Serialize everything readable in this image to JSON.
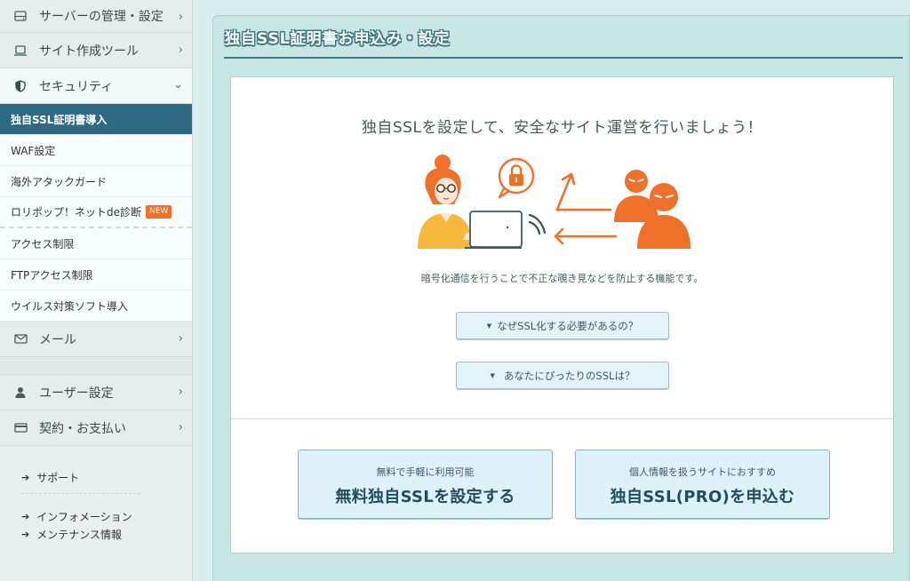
{
  "sidebar": {
    "categories": {
      "server": {
        "label": "サーバーの管理・設定",
        "icon": "server-icon"
      },
      "site": {
        "label": "サイト作成ツール",
        "icon": "laptop-icon"
      },
      "security": {
        "label": "セキュリティ",
        "icon": "shield-icon"
      },
      "mail": {
        "label": "メール",
        "icon": "mail-icon"
      },
      "user": {
        "label": "ユーザー設定",
        "icon": "user-icon"
      },
      "contract": {
        "label": "契約・お支払い",
        "icon": "card-icon"
      }
    },
    "security_items": [
      {
        "label": "独自SSL証明書導入"
      },
      {
        "label": "WAF設定"
      },
      {
        "label": "海外アタックガード"
      },
      {
        "label": "ロリポップ！ネットde診断",
        "badge": "NEW"
      },
      {
        "label": "アクセス制限"
      },
      {
        "label": "FTPアクセス制限"
      },
      {
        "label": "ウイルス対策ソフト導入"
      }
    ],
    "links": {
      "support": "サポート",
      "information": "インフォメーション",
      "maintenance": "メンテナンス情報"
    }
  },
  "main": {
    "title": "独自SSL証明書お申込み・設定",
    "headline": "独自SSLを設定して、安全なサイト運営を行いましょう！",
    "description": "暗号化通信を行うことで不正な覗き見などを防止する機能です。",
    "toggles": {
      "why": "なぜSSL化する必要があるの？",
      "which": "あなたにぴったりのSSLは？"
    },
    "cta_free": {
      "small": "無料で手軽に利用可能",
      "big": "無料独自SSLを設定する"
    },
    "cta_pro": {
      "small": "個人情報を扱うサイトにおすすめ",
      "big": "独自SSL(PRO)を申込む"
    }
  },
  "colors": {
    "active_nav": "#2d6a82",
    "accent_orange": "#f0702a",
    "badge": "#f0702a",
    "title_outline": "#3d7a7e"
  }
}
